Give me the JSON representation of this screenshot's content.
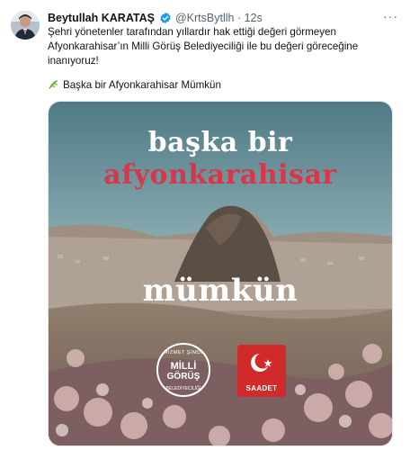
{
  "author": {
    "name": "Beytullah KARATAŞ",
    "handle": "@KrtsBytllh",
    "separator": "·",
    "time": "12s"
  },
  "tweet": {
    "text": "Şehri yönetenler tarafından yıllardır hak ettiği değeri görmeyen Afyonkarahisar’ın Milli Görüş Belediyeciliği ile bu değeri göreceğine inanıyoruz!",
    "tagline": "Başka bir Afyonkarahisar Mümkün"
  },
  "more_label": "···",
  "media": {
    "headline_1": "başka bir",
    "headline_2": "afyonkarahisar",
    "headline_3": "mümkün",
    "badge_top": "HİZMET ŞİMDİ",
    "badge_mid1": "MİLLİ",
    "badge_mid2": "GÖRÜŞ",
    "badge_bot": "BELEDİYECİLİĞİ",
    "party": "SAADET"
  },
  "colors": {
    "verified": "#1d9bf0",
    "accent_red": "#d7374a",
    "secondary_text": "#536471"
  }
}
